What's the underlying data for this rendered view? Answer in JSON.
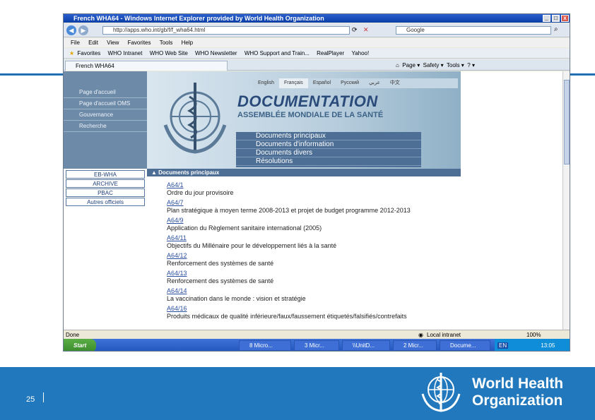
{
  "window": {
    "title": "French WHA64 - Windows Internet Explorer provided by World Health Organization",
    "controls": [
      "_",
      "□",
      "x"
    ]
  },
  "address_bar": {
    "url": "http://apps.who.int/gb/f/f_wha64.html",
    "search_placeholder": "Google"
  },
  "menu": [
    "File",
    "Edit",
    "View",
    "Favorites",
    "Tools",
    "Help"
  ],
  "favorites_bar": {
    "label": "Favorites",
    "links": [
      "WHO Intranet",
      "WHO Web Site",
      "WHO Newsletter",
      "WHO Support and Train...",
      "RealPlayer",
      "Yahoo!"
    ]
  },
  "tab": {
    "label": "French WHA64"
  },
  "command_bar": {
    "items": [
      "Page ▾",
      "Safety ▾",
      "Tools ▾",
      "? ▾"
    ]
  },
  "page": {
    "left_nav": [
      "Page d'accueil",
      "Page d'accueil OMS",
      "Gouvernance",
      "Recherche"
    ],
    "languages": [
      "English",
      "Français",
      "Español",
      "Русский",
      "عربي",
      "中文"
    ],
    "active_language_index": 1,
    "doc_title": "DOCUMENTATION",
    "doc_subtitle": "ASSEMBLÉE MONDIALE DE LA SANTÉ",
    "categories": [
      "Documents principaux",
      "Documents d'information",
      "Documents divers",
      "Résolutions"
    ],
    "side_links": [
      "EB-WHA",
      "ARCHIVE",
      "PBAC",
      "Autres officiels"
    ],
    "section_heading": "▲ Documents principaux",
    "documents": [
      {
        "code": "A64/1",
        "desc": "Ordre du jour provisoire"
      },
      {
        "code": "A64/7",
        "desc": "Plan stratégique à moyen terme 2008-2013 et projet de budget programme 2012-2013"
      },
      {
        "code": "A64/9",
        "desc": "Application du Règlement sanitaire international (2005)"
      },
      {
        "code": "A64/11",
        "desc": "Objectifs du Millénaire pour le développement liés à la santé"
      },
      {
        "code": "A64/12",
        "desc": "Renforcement des systèmes de santé"
      },
      {
        "code": "A64/13",
        "desc": "Renforcement des systèmes de santé"
      },
      {
        "code": "A64/14",
        "desc": "La vaccination dans le monde : vision et stratégie"
      },
      {
        "code": "A64/16",
        "desc": "Produits médicaux de qualité inférieure/faux/faussement étiquetés/falsifiés/contrefaits"
      }
    ]
  },
  "status_bar": {
    "left": "Done",
    "zone": "Local intranet",
    "zoom": "100%"
  },
  "taskbar": {
    "start": "Start",
    "tasks": [
      "8 Micro...",
      "3 Micr...",
      "\\\\UnitD...",
      "2 Micr...",
      "Docume..."
    ],
    "lang": "EN",
    "clock": "13:05"
  },
  "slide": {
    "page_number": "25",
    "org_line1": "World Health",
    "org_line2": "Organization"
  },
  "colors": {
    "brand_blue": "#2178bc",
    "nav_blue": "#6d8aa8",
    "category_blue": "#4d6f95"
  }
}
